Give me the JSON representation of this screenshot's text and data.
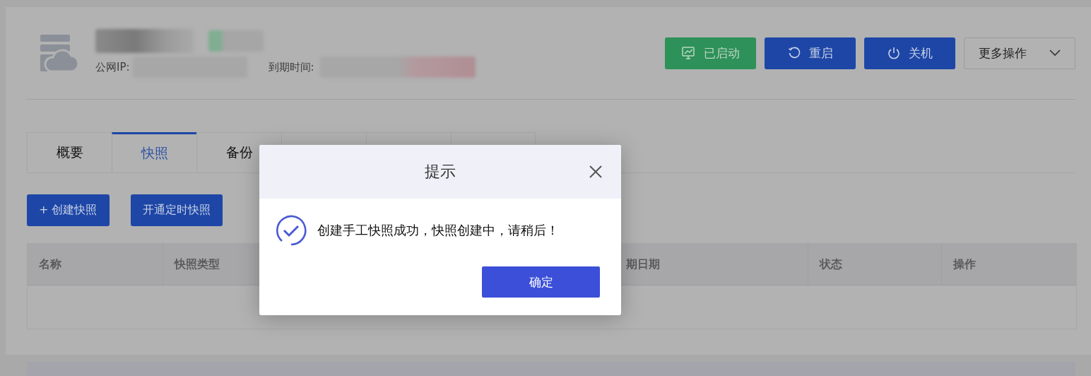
{
  "server": {
    "ip_label": "公网IP:",
    "expiry_label": "到期时间:"
  },
  "actions": [
    {
      "kind": "status",
      "label": "已启动"
    },
    {
      "kind": "restart",
      "label": "重启"
    },
    {
      "kind": "power",
      "label": "关机"
    },
    {
      "kind": "dropdown",
      "label": "更多操作"
    }
  ],
  "tabs": [
    {
      "label": "概要",
      "selected": false
    },
    {
      "label": "快照",
      "selected": true
    },
    {
      "label": "备份",
      "selected": false
    }
  ],
  "toolbar": [
    {
      "label": "+ 创建快照"
    },
    {
      "label": "开通定时快照"
    }
  ],
  "table": {
    "columns": [
      "名称",
      "快照类型",
      "",
      "期日期",
      "状态",
      "操作"
    ]
  },
  "dialog": {
    "title": "提示",
    "message": "创建手工快照成功，快照创建中，请稍后！",
    "confirm": "确定"
  }
}
